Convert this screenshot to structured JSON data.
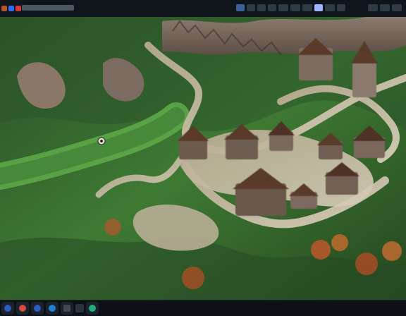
{
  "app": {
    "colors": {
      "accent": "#3a5f99",
      "accent_highlight": "#9db4ff",
      "surface": "#10151b",
      "map_grass_dark": "#2f5a2a",
      "map_grass": "#4f8a3d",
      "map_dirt": "#cbbfa8",
      "map_stone": "#7a6a5e",
      "map_roof": "#5a3a2c",
      "map_autumn": "#b5562a"
    },
    "icons": {
      "menu": "menu-icon",
      "search": "search-icon",
      "settings": "gear-icon",
      "minimize": "minimize-icon",
      "maximize": "maximize-icon",
      "close": "close-icon",
      "taskbar": [
        "power-icon",
        "record-icon",
        "edit-icon",
        "refresh-icon",
        "grid-icon",
        "stop-icon",
        "eye-icon"
      ]
    }
  },
  "topbar": {
    "title": "",
    "tabs": [
      {
        "label": ""
      },
      {
        "label": ""
      },
      {
        "label": ""
      },
      {
        "label": ""
      },
      {
        "label": ""
      },
      {
        "label": ""
      },
      {
        "label": ""
      },
      {
        "label": ""
      },
      {
        "label": ""
      },
      {
        "label": ""
      }
    ]
  },
  "statusbar": {
    "left": "",
    "right": ""
  }
}
